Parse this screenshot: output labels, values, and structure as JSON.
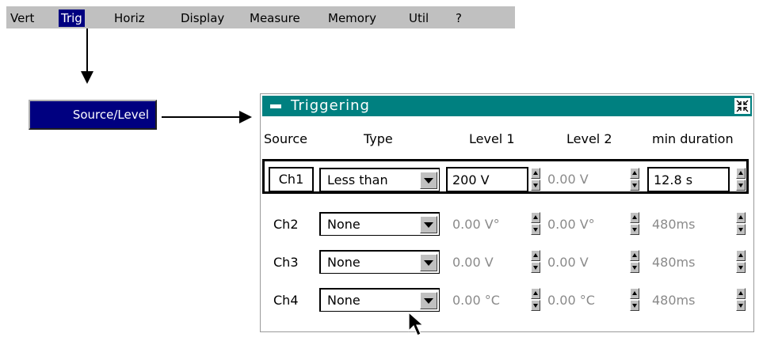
{
  "menu": {
    "items": [
      {
        "label": "Vert"
      },
      {
        "label": "Trig"
      },
      {
        "label": "Horiz"
      },
      {
        "label": "Display"
      },
      {
        "label": "Measure"
      },
      {
        "label": "Memory"
      },
      {
        "label": "Util"
      },
      {
        "label": "?"
      }
    ],
    "active": "Trig"
  },
  "submenu": {
    "source_level_label": "Source/Level"
  },
  "dialog": {
    "title": "Triggering",
    "columns": {
      "source": "Source",
      "type": "Type",
      "level1": "Level 1",
      "level2": "Level 2",
      "min_duration": "min duration"
    },
    "rows": [
      {
        "channel": "Ch1",
        "type": "Less than",
        "level1": "200 V",
        "level2": "0.00 V",
        "min_duration": "12.8 s"
      },
      {
        "channel": "Ch2",
        "type": "None",
        "level1": "0.00 V°",
        "level2": "0.00 V°",
        "min_duration": "480ms"
      },
      {
        "channel": "Ch3",
        "type": "None",
        "level1": "0.00 V",
        "level2": "0.00 V",
        "min_duration": "480ms"
      },
      {
        "channel": "Ch4",
        "type": "None",
        "level1": "0.00 °C",
        "level2": "0.00 °C",
        "min_duration": "480ms"
      }
    ]
  },
  "colors": {
    "menubar": "#c0c0c0",
    "active_menu": "#000080",
    "title_bar": "#008080",
    "disabled_text": "#8a8a8a"
  },
  "icons": {
    "title_left": "minimize-icon",
    "title_right": "collapse-icon",
    "dropdown": "chevron-down-icon",
    "spinner": "spinner-icon",
    "pointer": "mouse-pointer-icon"
  }
}
